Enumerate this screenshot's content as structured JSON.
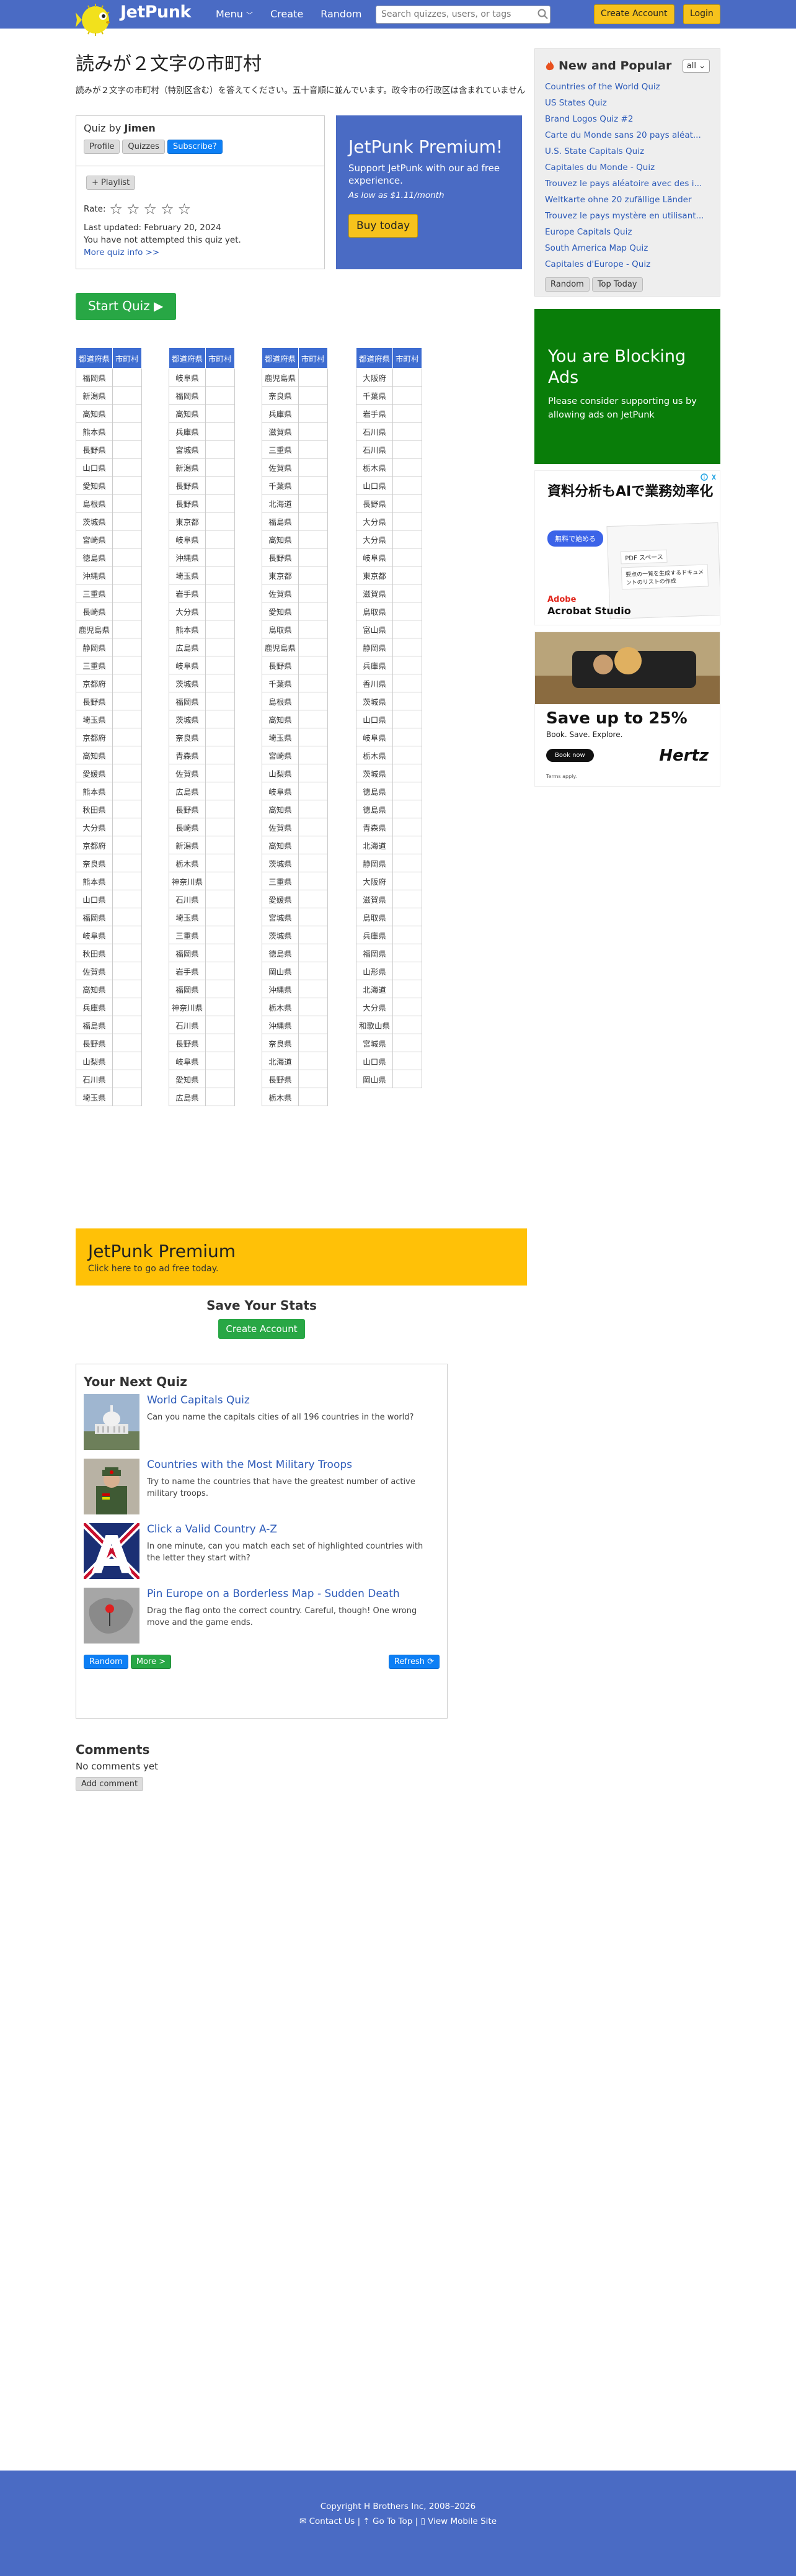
{
  "header": {
    "logo": "JetPunk",
    "nav": [
      "Menu",
      "Create",
      "Random"
    ],
    "search_placeholder": "Search quizzes, users, or tags",
    "create_account": "Create Account",
    "login": "Login"
  },
  "quiz": {
    "title": "読みが２文字の市町村",
    "description": "読みが２文字の市町村（特別区含む）を答えてください。五十音順に並んでいます。政令市の行政区は含まれていません",
    "quiz_by_label": "Quiz by",
    "author": "Jimen",
    "buttons": [
      "Profile",
      "Quizzes",
      "Subscribe?"
    ],
    "playlist": "+ Playlist",
    "rate_label": "Rate:",
    "last_updated": "Last updated: February 20, 2024",
    "not_attempted": "You have not attempted this quiz yet.",
    "more_info": "More quiz info >>",
    "start": "Start Quiz ▶"
  },
  "premium_box": {
    "title": "JetPunk Premium!",
    "text": "Support JetPunk with our ad free experience.",
    "price": "As low as $1.11/month",
    "button": "Buy today"
  },
  "table": {
    "headers": [
      "都道府県",
      "市町村"
    ],
    "columns": [
      [
        "福岡県",
        "新潟県",
        "高知県",
        "熊本県",
        "長野県",
        "山口県",
        "愛知県",
        "島根県",
        "茨城県",
        "宮崎県",
        "徳島県",
        "沖縄県",
        "三重県",
        "長崎県",
        "鹿児島県",
        "静岡県",
        "三重県",
        "京都府",
        "長野県",
        "埼玉県",
        "京都府",
        "高知県",
        "愛媛県",
        "熊本県",
        "秋田県",
        "大分県",
        "京都府",
        "奈良県",
        "熊本県",
        "山口県",
        "福岡県",
        "岐阜県",
        "秋田県",
        "佐賀県",
        "高知県",
        "兵庫県",
        "福島県",
        "長野県",
        "山梨県",
        "石川県",
        "埼玉県"
      ],
      [
        "岐阜県",
        "福岡県",
        "高知県",
        "兵庫県",
        "宮城県",
        "新潟県",
        "長野県",
        "長野県",
        "東京都",
        "岐阜県",
        "沖縄県",
        "埼玉県",
        "岩手県",
        "大分県",
        "熊本県",
        "広島県",
        "岐阜県",
        "茨城県",
        "福岡県",
        "茨城県",
        "奈良県",
        "青森県",
        "佐賀県",
        "広島県",
        "長野県",
        "長崎県",
        "新潟県",
        "栃木県",
        "神奈川県",
        "石川県",
        "埼玉県",
        "三重県",
        "福岡県",
        "岩手県",
        "福岡県",
        "神奈川県",
        "石川県",
        "長野県",
        "岐阜県",
        "愛知県",
        "広島県"
      ],
      [
        "鹿児島県",
        "奈良県",
        "兵庫県",
        "滋賀県",
        "三重県",
        "佐賀県",
        "千葉県",
        "北海道",
        "福島県",
        "高知県",
        "長野県",
        "東京都",
        "佐賀県",
        "愛知県",
        "鳥取県",
        "鹿児島県",
        "長野県",
        "千葉県",
        "島根県",
        "高知県",
        "埼玉県",
        "宮崎県",
        "山梨県",
        "岐阜県",
        "高知県",
        "佐賀県",
        "高知県",
        "茨城県",
        "三重県",
        "愛媛県",
        "宮城県",
        "茨城県",
        "徳島県",
        "岡山県",
        "沖縄県",
        "栃木県",
        "沖縄県",
        "奈良県",
        "北海道",
        "長野県",
        "栃木県"
      ],
      [
        "大阪府",
        "千葉県",
        "岩手県",
        "石川県",
        "石川県",
        "栃木県",
        "山口県",
        "長野県",
        "大分県",
        "大分県",
        "岐阜県",
        "東京都",
        "滋賀県",
        "鳥取県",
        "富山県",
        "静岡県",
        "兵庫県",
        "香川県",
        "茨城県",
        "山口県",
        "岐阜県",
        "栃木県",
        "茨城県",
        "徳島県",
        "徳島県",
        "青森県",
        "北海道",
        "静岡県",
        "大阪府",
        "滋賀県",
        "鳥取県",
        "兵庫県",
        "福岡県",
        "山形県",
        "北海道",
        "大分県",
        "和歌山県",
        "宮城県",
        "山口県",
        "岡山県"
      ]
    ]
  },
  "premium_bar": {
    "title": "JetPunk Premium",
    "subtitle": "Click here to go ad free today."
  },
  "save_stats": {
    "title": "Save Your Stats",
    "button": "Create Account"
  },
  "next_quiz": {
    "heading": "Your Next Quiz",
    "items": [
      {
        "title": "World Capitals Quiz",
        "desc": "Can you name the capitals cities of all 196 countries in the world?"
      },
      {
        "title": "Countries with the Most Military Troops",
        "desc": "Try to name the countries that have the greatest number of active military troops."
      },
      {
        "title": "Click a Valid Country A-Z",
        "desc": "In one minute, can you match each set of highlighted countries with the letter they start with?"
      },
      {
        "title": "Pin Europe on a Borderless Map - Sudden Death",
        "desc": "Drag the flag onto the correct country. Careful, though! One wrong move and the game ends."
      }
    ],
    "random": "Random",
    "more": "More >",
    "refresh": "Refresh ⟳"
  },
  "comments": {
    "heading": "Comments",
    "none": "No comments yet",
    "add": "Add comment"
  },
  "sidebar": {
    "heading": "New and Popular",
    "select": "all",
    "links": [
      "Countries of the World Quiz",
      "US States Quiz",
      "Brand Logos Quiz #2",
      "Carte du Monde sans 20 pays aléat...",
      "U.S. State Capitals Quiz",
      "Capitales du Monde - Quiz",
      "Trouvez le pays aléatoire avec des i...",
      "Weltkarte ohne 20 zufällige Länder",
      "Trouvez le pays mystère en utilisant...",
      "Europe Capitals Quiz",
      "South America Map Quiz",
      "Capitales d'Europe - Quiz"
    ],
    "random": "Random",
    "top_today": "Top Today"
  },
  "blocking": {
    "title": "You are Blocking Ads",
    "text": "Please consider supporting us by allowing ads on JetPunk"
  },
  "ad1": {
    "headline": "資料分析もAIで業務効率化",
    "cta": "無料で始める",
    "brand": "Adobe",
    "product": "Acrobat Studio",
    "panel_title": "PDF スペース",
    "panel_line": "要点の一覧を生成するドキュメントのリストの作成"
  },
  "ad2": {
    "headline": "Save up to 25%",
    "sub": "Book. Save. Explore.",
    "cta": "Book now",
    "brand": "Hertz",
    "fine": "Terms apply."
  },
  "footer": {
    "copyright": "Copyright H Brothers Inc, 2008–2026",
    "links": "✉ Contact Us | ⇡ Go To Top | ▯ View Mobile Site"
  }
}
